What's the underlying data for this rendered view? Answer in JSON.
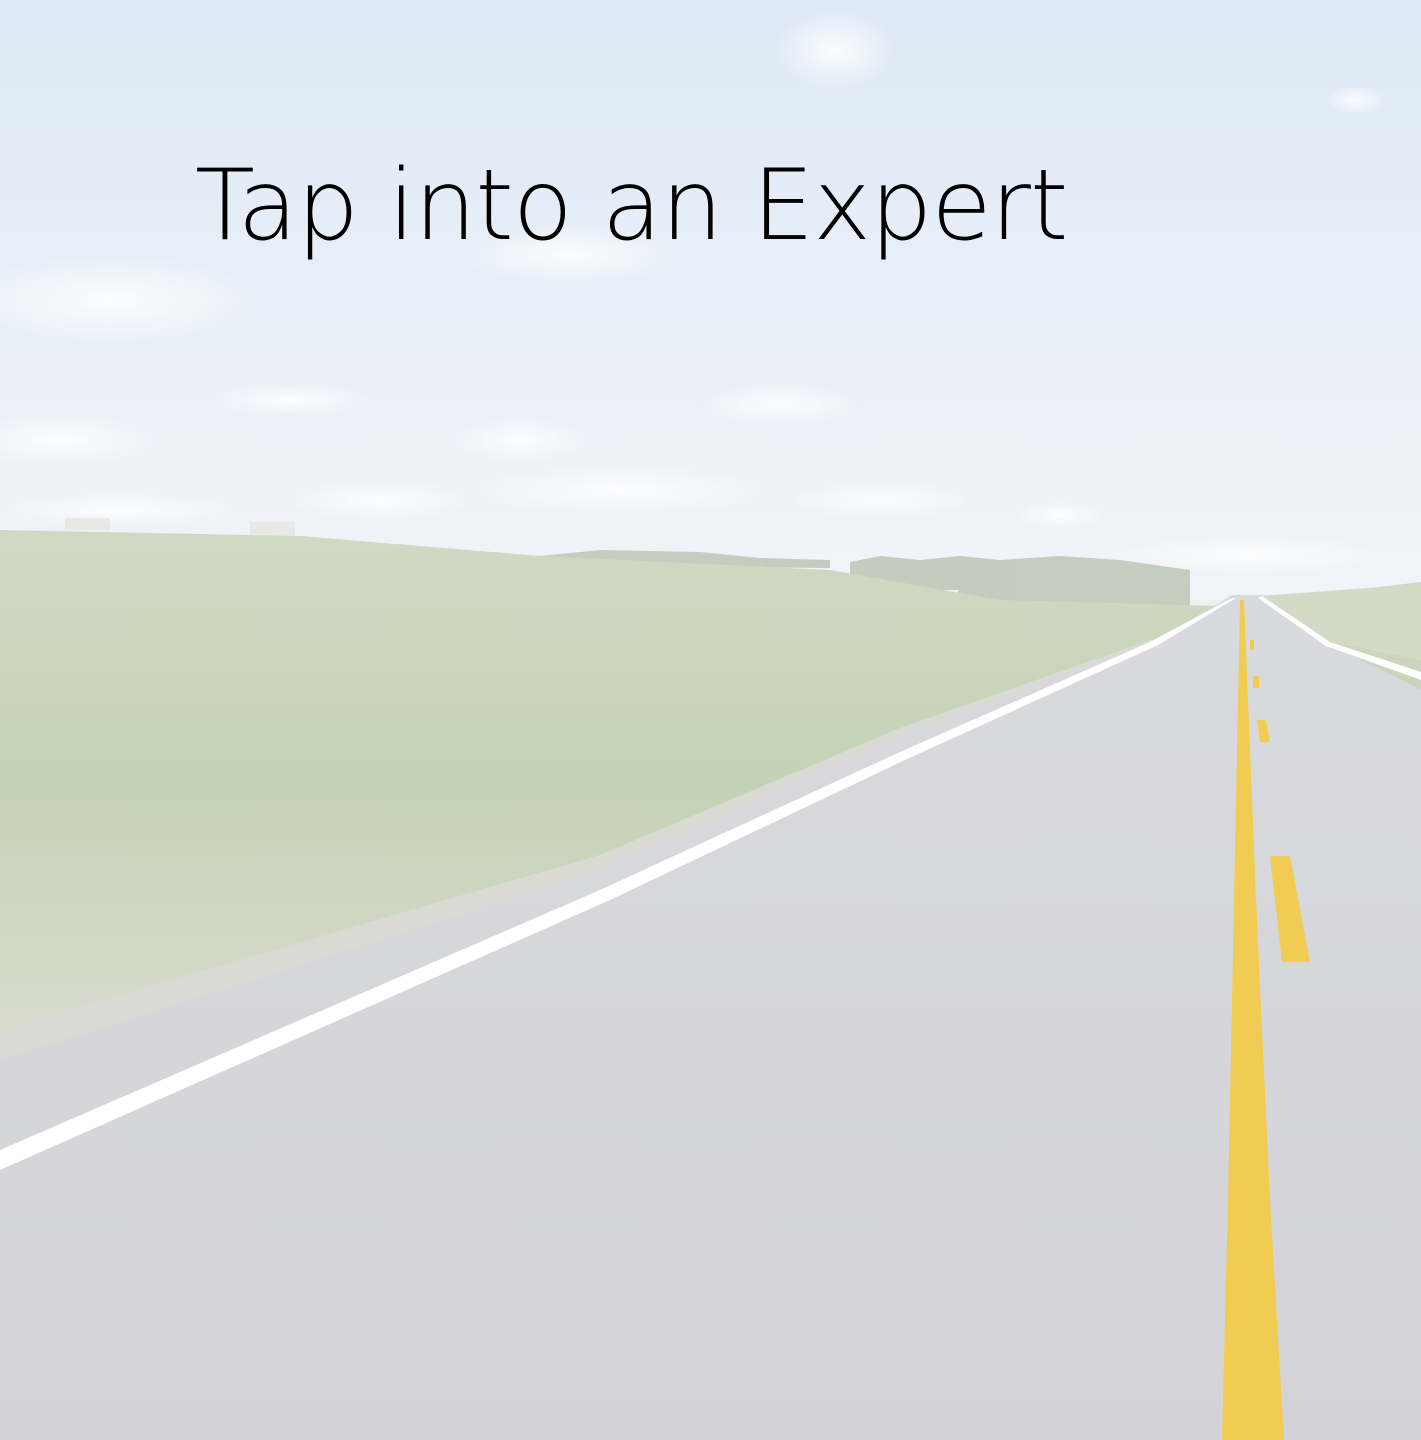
{
  "slide": {
    "title": "Tap into an Expert"
  },
  "colors": {
    "sky_top": "#dde9f5",
    "sky_bottom": "#eef3f8",
    "grass": "#c8d5b8",
    "road": "#d7d7db",
    "center_line": "#f2cf4a",
    "edge_line": "#ffffff",
    "title_text": "#000000"
  }
}
